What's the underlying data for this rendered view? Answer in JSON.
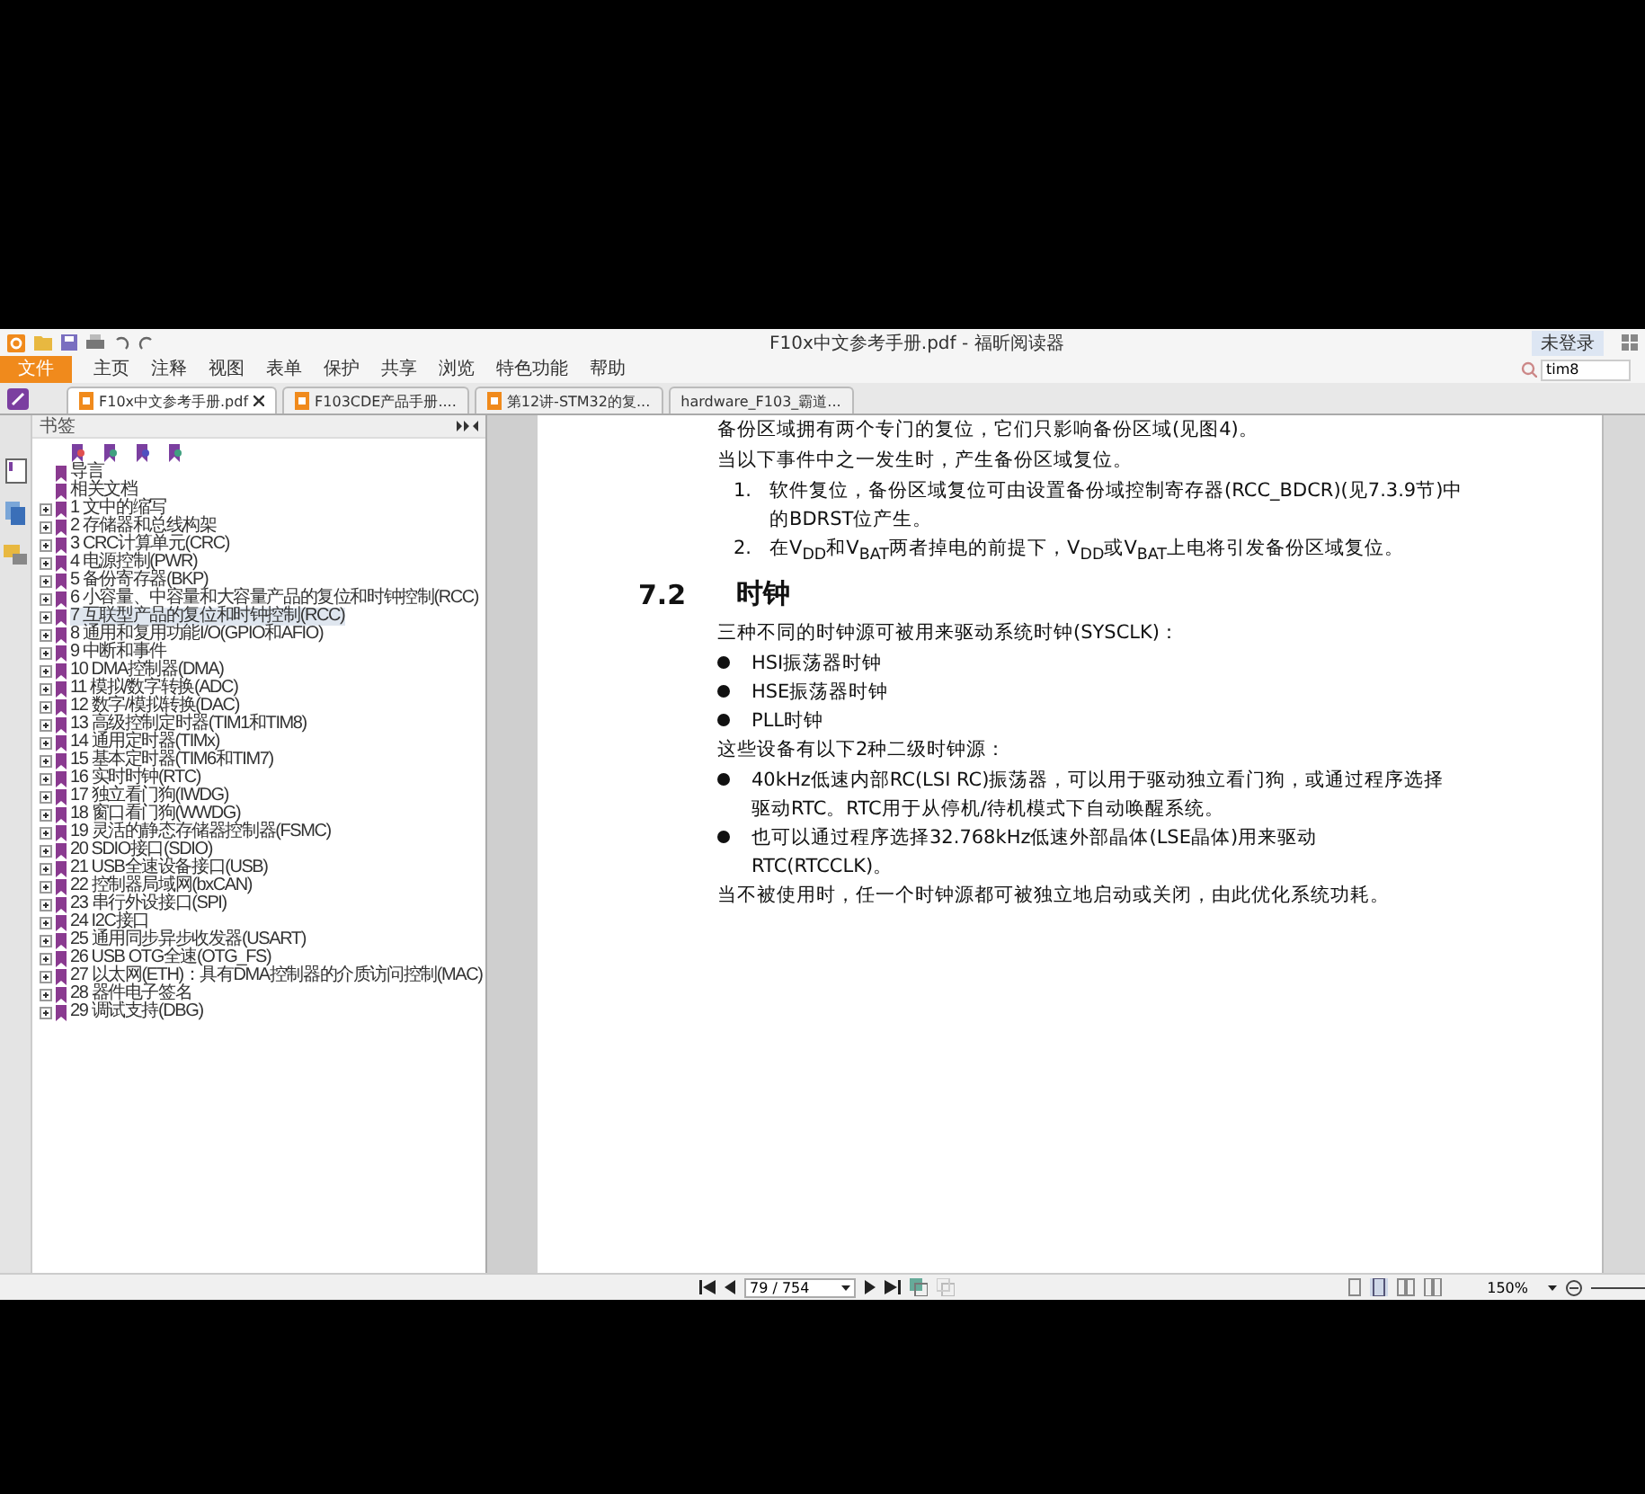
{
  "window": {
    "title": "F10x中文参考手册.pdf - 福昕阅读器",
    "login": "未登录"
  },
  "menu": [
    {
      "label": "文件",
      "selected": true
    },
    {
      "label": "主页",
      "selected": false
    },
    {
      "label": "注释",
      "selected": false
    },
    {
      "label": "视图",
      "selected": false
    },
    {
      "label": "表单",
      "selected": false
    },
    {
      "label": "保护",
      "selected": false
    },
    {
      "label": "共享",
      "selected": false
    },
    {
      "label": "浏览",
      "selected": false
    },
    {
      "label": "特色功能",
      "selected": false
    },
    {
      "label": "帮助",
      "selected": false
    }
  ],
  "search": {
    "value": "tim8"
  },
  "tabs": [
    {
      "label": "F10x中文参考手册.pdf",
      "selected": true,
      "closable": true
    },
    {
      "label": "F103CDE产品手册....",
      "selected": false,
      "closable": false
    },
    {
      "label": "第12讲-STM32的复...",
      "selected": false,
      "closable": false
    },
    {
      "label": "hardware_F103_霸道...",
      "selected": false,
      "closable": false
    }
  ],
  "sidebar": {
    "title": "书签",
    "items": [
      {
        "label": "导言",
        "expandable": false,
        "selected": false
      },
      {
        "label": "相关文档",
        "expandable": false,
        "selected": false
      },
      {
        "label": "1 文中的缩写",
        "expandable": true,
        "selected": false
      },
      {
        "label": "2 存储器和总线构架",
        "expandable": true,
        "selected": false
      },
      {
        "label": "3 CRC计算单元(CRC)",
        "expandable": true,
        "selected": false
      },
      {
        "label": "4 电源控制(PWR)",
        "expandable": true,
        "selected": false
      },
      {
        "label": "5 备份寄存器(BKP)",
        "expandable": true,
        "selected": false
      },
      {
        "label": "6 小容量、中容量和大容量产品的复位和时钟控制(RCC)",
        "expandable": true,
        "selected": false
      },
      {
        "label": "7 互联型产品的复位和时钟控制(RCC)",
        "expandable": true,
        "selected": true
      },
      {
        "label": "8 通用和复用功能I/O(GPIO和AFIO)",
        "expandable": true,
        "selected": false
      },
      {
        "label": "9 中断和事件",
        "expandable": true,
        "selected": false
      },
      {
        "label": "10 DMA控制器(DMA)",
        "expandable": true,
        "selected": false
      },
      {
        "label": "11 模拟/数字转换(ADC)",
        "expandable": true,
        "selected": false
      },
      {
        "label": "12 数字/模拟转换(DAC)",
        "expandable": true,
        "selected": false
      },
      {
        "label": "13 高级控制定时器(TIM1和TIM8)",
        "expandable": true,
        "selected": false
      },
      {
        "label": "14 通用定时器(TIMx)",
        "expandable": true,
        "selected": false
      },
      {
        "label": "15 基本定时器(TIM6和TIM7)",
        "expandable": true,
        "selected": false
      },
      {
        "label": "16 实时时钟(RTC)",
        "expandable": true,
        "selected": false
      },
      {
        "label": "17 独立看门狗(IWDG)",
        "expandable": true,
        "selected": false
      },
      {
        "label": "18 窗口看门狗(WWDG)",
        "expandable": true,
        "selected": false
      },
      {
        "label": "19 灵活的静态存储器控制器(FSMC)",
        "expandable": true,
        "selected": false
      },
      {
        "label": "20 SDIO接口(SDIO)",
        "expandable": true,
        "selected": false
      },
      {
        "label": "21 USB全速设备接口(USB)",
        "expandable": true,
        "selected": false
      },
      {
        "label": "22 控制器局域网(bxCAN)",
        "expandable": true,
        "selected": false
      },
      {
        "label": "23 串行外设接口(SPI)",
        "expandable": true,
        "selected": false
      },
      {
        "label": "24 I2C接口",
        "expandable": true,
        "selected": false
      },
      {
        "label": "25 通用同步异步收发器(USART)",
        "expandable": true,
        "selected": false
      },
      {
        "label": "26 USB OTG全速(OTG_FS)",
        "expandable": true,
        "selected": false
      },
      {
        "label": "27 以太网(ETH)：具有DMA控制器的介质访问控制(MAC)",
        "expandable": true,
        "selected": false
      },
      {
        "label": "28 器件电子签名",
        "expandable": true,
        "selected": false
      },
      {
        "label": "29 调试支持(DBG)",
        "expandable": true,
        "selected": false
      }
    ]
  },
  "document": {
    "blocks": [
      {
        "kind": "para",
        "text": "备份区域拥有两个专门的复位，它们只影响备份区域(见图4)。"
      },
      {
        "kind": "para",
        "text": "当以下事件中之一发生时，产生备份区域复位。"
      },
      {
        "kind": "numbered",
        "marker": "1.",
        "text": "软件复位，备份区域复位可由设置备份域控制寄存器(RCC_BDCR)(见7.3.9节)中的BDRST位产生。"
      },
      {
        "kind": "numbered",
        "marker": "2.",
        "text": "在V$_{DD}$和V$_{BAT}$两者掉电的前提下，V$_{DD}$或V$_{BAT}$上电将引发备份区域复位。"
      },
      {
        "kind": "heading",
        "marker": "7.2",
        "text": "时钟"
      },
      {
        "kind": "para",
        "text": "三种不同的时钟源可被用来驱动系统时钟(SYSCLK)："
      },
      {
        "kind": "bullet",
        "text": "HSI振荡器时钟"
      },
      {
        "kind": "bullet",
        "text": "HSE振荡器时钟"
      },
      {
        "kind": "bullet",
        "text": "PLL时钟"
      },
      {
        "kind": "para",
        "text": "这些设备有以下2种二级时钟源："
      },
      {
        "kind": "bullet",
        "text": "40kHz低速内部RC(LSI RC)振荡器，可以用于驱动独立看门狗，或通过程序选择驱动RTC。RTC用于从停机/待机模式下自动唤醒系统。"
      },
      {
        "kind": "bullet",
        "text": "也可以通过程序选择32.768kHz低速外部晶体(LSE晶体)用来驱动RTC(RTCCLK)。"
      },
      {
        "kind": "para",
        "text": "当不被使用时，任一个时钟源都可被独立地启动或关闭，由此优化系统功耗。"
      }
    ]
  },
  "status_bar": {
    "page": "79 / 754",
    "zoom": "150%"
  }
}
